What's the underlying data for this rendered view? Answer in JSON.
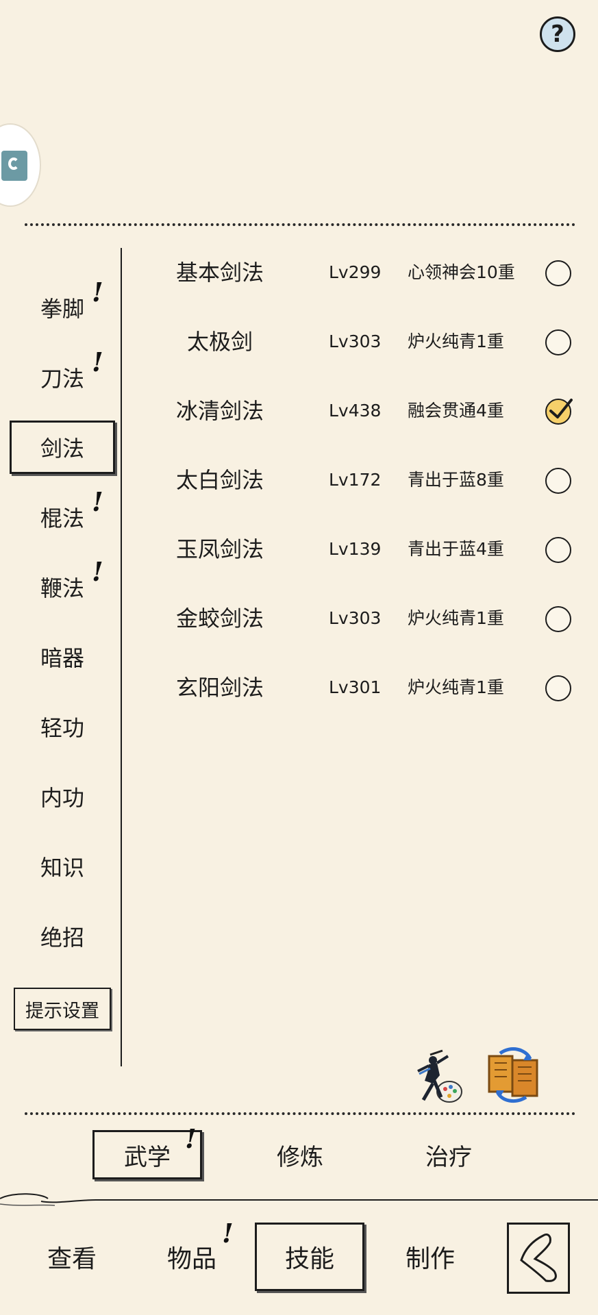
{
  "header": {
    "help_symbol": "?"
  },
  "categories": [
    {
      "label": "拳脚",
      "alert": true
    },
    {
      "label": "刀法",
      "alert": true
    },
    {
      "label": "剑法",
      "alert": false,
      "active": true
    },
    {
      "label": "棍法",
      "alert": true
    },
    {
      "label": "鞭法",
      "alert": true
    },
    {
      "label": "暗器",
      "alert": false
    },
    {
      "label": "轻功",
      "alert": false
    },
    {
      "label": "内功",
      "alert": false
    },
    {
      "label": "知识",
      "alert": false
    },
    {
      "label": "绝招",
      "alert": false
    }
  ],
  "alert_mark": "!",
  "hint_settings_label": "提示设置",
  "skills": [
    {
      "name": "基本剑法",
      "level": "Lv299",
      "realm": "心领神会10重",
      "selected": false
    },
    {
      "name": "太极剑",
      "level": "Lv303",
      "realm": "炉火纯青1重",
      "selected": false
    },
    {
      "name": "冰清剑法",
      "level": "Lv438",
      "realm": "融会贯通4重",
      "selected": true
    },
    {
      "name": "太白剑法",
      "level": "Lv172",
      "realm": "青出于蓝8重",
      "selected": false
    },
    {
      "name": "玉凤剑法",
      "level": "Lv139",
      "realm": "青出于蓝4重",
      "selected": false
    },
    {
      "name": "金蛟剑法",
      "level": "Lv303",
      "realm": "炉火纯青1重",
      "selected": false
    },
    {
      "name": "玄阳剑法",
      "level": "Lv301",
      "realm": "炉火纯青1重",
      "selected": false
    }
  ],
  "sub_tabs": [
    {
      "label": "武学",
      "active": true,
      "alert": true
    },
    {
      "label": "修炼",
      "active": false,
      "alert": false
    },
    {
      "label": "治疗",
      "active": false,
      "alert": false
    }
  ],
  "nav_tabs": [
    {
      "label": "查看",
      "active": false,
      "alert": false
    },
    {
      "label": "物品",
      "active": false,
      "alert": true
    },
    {
      "label": "技能",
      "active": true,
      "alert": false
    },
    {
      "label": "制作",
      "active": false,
      "alert": false
    }
  ],
  "icons": {
    "help": "question-mark-icon",
    "side": "game-app-icon",
    "fighter": "martial-artist-icon",
    "swap": "swap-scroll-icon",
    "back": "back-arrow-icon"
  },
  "colors": {
    "background": "#f8f1e2",
    "ink": "#1c1c1c",
    "check_fill": "#f6d06a",
    "help_fill": "#cfe2ee"
  }
}
